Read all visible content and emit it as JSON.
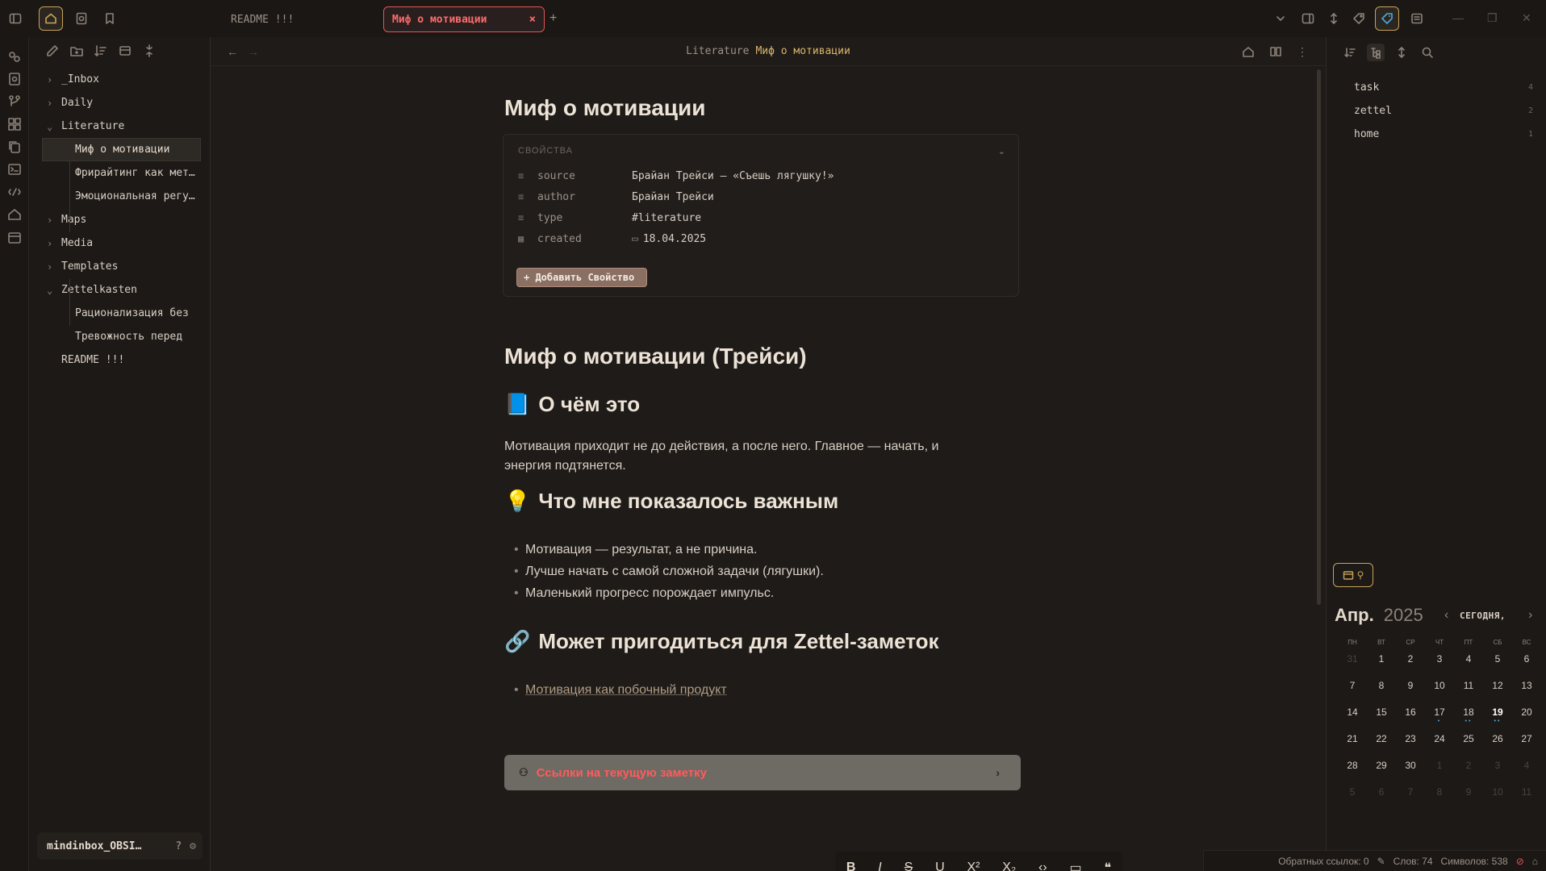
{
  "tabs": {
    "inactive_label": "README !!!",
    "active_label": "Миф о мотивации",
    "close": "×",
    "new": "+"
  },
  "window": {
    "minimize": "—",
    "maximize": "❐",
    "close": "✕"
  },
  "file_tree": {
    "items": [
      {
        "label": "_Inbox",
        "chevron": "›"
      },
      {
        "label": "Daily",
        "chevron": "›"
      },
      {
        "label": "Literature",
        "chevron": "⌄"
      },
      {
        "label": "Миф о мотивации"
      },
      {
        "label": "Фрирайтинг как метод"
      },
      {
        "label": "Эмоциональная регуляция"
      },
      {
        "label": "Maps",
        "chevron": "›"
      },
      {
        "label": "Media",
        "chevron": "›"
      },
      {
        "label": "Templates",
        "chevron": "›"
      },
      {
        "label": "Zettelkasten",
        "chevron": "⌄"
      },
      {
        "label": "Рационализация без"
      },
      {
        "label": "Тревожность перед"
      },
      {
        "label": "README !!!"
      }
    ]
  },
  "vault": {
    "name": "mindinbox_OBSI…",
    "help": "?",
    "settings": "⚙"
  },
  "header": {
    "back": "←",
    "forward": "→",
    "breadcrumb_folder": "Literature",
    "breadcrumb_note": "Миф о мотивации",
    "more": "⋮"
  },
  "note": {
    "title": "Миф о мотивации",
    "properties": {
      "heading": "СВОЙСТВА",
      "rows": [
        {
          "key": "source",
          "value": "Брайан Трейси — «Съешь лягушку!»",
          "icon": "≡"
        },
        {
          "key": "author",
          "value": "Брайан Трейси",
          "icon": "≡"
        },
        {
          "key": "type",
          "value": "#literature",
          "icon": "≡"
        },
        {
          "key": "created",
          "value": "18.04.2025",
          "icon": "▦"
        }
      ],
      "add_label": "+ Добавить Свойство"
    },
    "h1": "Миф о мотивации (Трейси)",
    "section1": {
      "emoji": "📘",
      "title": "О чём это"
    },
    "paragraph": "Мотивация приходит не до действия, а после него. Главное — начать, и энергия подтянется.",
    "section2": {
      "emoji": "💡",
      "title": "Что мне показалось важным"
    },
    "bullets": [
      "Мотивация — результат, а не причина.",
      "Лучше начать с самой сложной задачи (лягушки).",
      "Маленький прогресс порождает импульс."
    ],
    "section3": {
      "emoji": "🔗",
      "title": "Может пригодиться для Zettel-заметок"
    },
    "link": "Мотивация как побочный продукт",
    "backlinks_label": "Ссылки на текущую заметку",
    "backlinks_chevron": "›"
  },
  "format_toolbar": [
    "B",
    "I",
    "S",
    "U",
    "X²",
    "X₂",
    "‹›",
    "▭",
    "❝"
  ],
  "tags": [
    {
      "name": "task",
      "count": "4"
    },
    {
      "name": "zettel",
      "count": "2"
    },
    {
      "name": "home",
      "count": "1"
    }
  ],
  "calendar": {
    "month": "Апр.",
    "year": "2025",
    "today_label": "СЕГОДНЯ,",
    "prev": "‹",
    "next": "›",
    "weekdays": [
      "ПН",
      "ВТ",
      "СР",
      "ЧТ",
      "ПТ",
      "СБ",
      "ВС"
    ],
    "weeks": [
      [
        "31",
        "1",
        "2",
        "3",
        "4",
        "5",
        "6"
      ],
      [
        "7",
        "8",
        "9",
        "10",
        "11",
        "12",
        "13"
      ],
      [
        "14",
        "15",
        "16",
        "17",
        "18",
        "19",
        "20"
      ],
      [
        "21",
        "22",
        "23",
        "24",
        "25",
        "26",
        "27"
      ],
      [
        "28",
        "29",
        "30",
        "1",
        "2",
        "3",
        "4"
      ],
      [
        "5",
        "6",
        "7",
        "8",
        "9",
        "10",
        "11"
      ]
    ],
    "dot_color": "#4fa8d8"
  },
  "status": {
    "backlinks": "Обратных ссылок: 0",
    "words": "Слов: 74",
    "chars": "Символов: 538"
  },
  "colors": {
    "accent": "#c9a35a",
    "active_tab": "#e05555",
    "background": "#1e1b18"
  }
}
